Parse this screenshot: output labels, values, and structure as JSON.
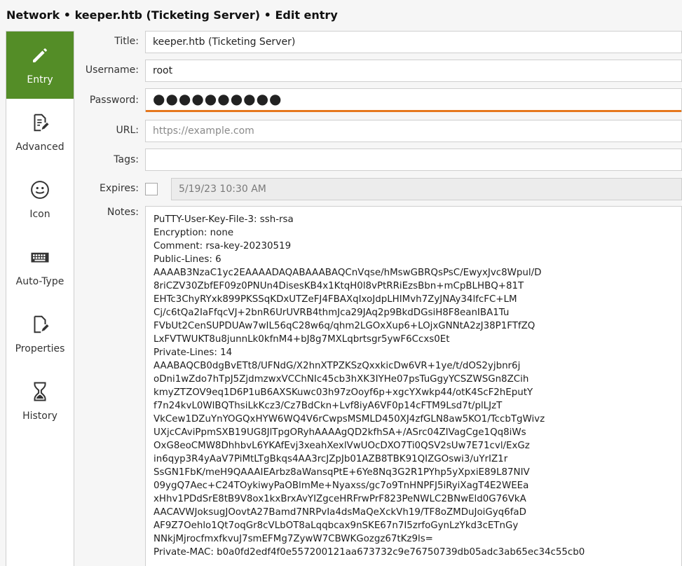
{
  "window": {
    "title": "Network • keeper.htb (Ticketing Server) • Edit entry"
  },
  "sidebar": {
    "items": [
      {
        "label": "Entry",
        "icon": "pencil-icon",
        "active": true
      },
      {
        "label": "Advanced",
        "icon": "document-edit-icon",
        "active": false
      },
      {
        "label": "Icon",
        "icon": "smiley-icon",
        "active": false
      },
      {
        "label": "Auto-Type",
        "icon": "keyboard-icon",
        "active": false
      },
      {
        "label": "Properties",
        "icon": "document-properties-icon",
        "active": false
      },
      {
        "label": "History",
        "icon": "hourglass-icon",
        "active": false
      }
    ]
  },
  "form": {
    "title_label": "Title:",
    "title_value": "keeper.htb (Ticketing Server)",
    "username_label": "Username:",
    "username_value": "root",
    "password_label": "Password:",
    "password_value": "●●●●●●●●●●",
    "url_label": "URL:",
    "url_placeholder": "https://example.com",
    "tags_label": "Tags:",
    "tags_value": "",
    "expires_label": "Expires:",
    "expires_value": "5/19/23 10:30 AM",
    "expires_checked": false,
    "notes_label": "Notes:",
    "notes_value": "PuTTY-User-Key-File-3: ssh-rsa\nEncryption: none\nComment: rsa-key-20230519\nPublic-Lines: 6\nAAAAB3NzaC1yc2EAAAADAQABAAABAQCnVqse/hMswGBRQsPsC/EwyxJvc8Wpul/D\n8riCZV30ZbfEF09z0PNUn4DisesKB4x1KtqH0l8vPtRRiEzsBbn+mCpBLHBQ+81T\nEHTc3ChyRYxk899PKSSqKDxUTZeFJ4FBAXqIxoJdpLHIMvh7ZyJNAy34lfcFC+LM\nCj/c6tQa2IaFfqcVJ+2bnR6UrUVRB4thmJca29JAq2p9BkdDGsiH8F8eanIBA1Tu\nFVbUt2CenSUPDUAw7wIL56qC28w6q/qhm2LGOxXup6+LOjxGNNtA2zJ38P1FTfZQ\nLxFVTWUKT8u8junnLk0kfnM4+bJ8g7MXLqbrtsgr5ywF6Ccxs0Et\nPrivate-Lines: 14\nAAABAQCB0dgBvETt8/UFNdG/X2hnXTPZKSzQxxkicDw6VR+1ye/t/dOS2yjbnr6j\noDni1wZdo7hTpJ5ZjdmzwxVCChNIc45cb3hXK3IYHe07psTuGgyYCSZWSGn8ZCih\nkmyZTZOV9eq1D6P1uB6AXSKuwc03h97zOoyf6p+xgcYXwkp44/otK4ScF2hEputY\nf7n24kvL0WlBQThsiLkKcz3/Cz7BdCkn+Lvf8iyA6VF0p14cFTM9Lsd7t/plLJzT\nVkCew1DZuYnYOGQxHYW6WQ4V6rCwpsMSMLD450XJ4zfGLN8aw5KO1/TccbTgWivz\nUXjcCAviPpmSXB19UG8JlTpgORyhAAAAgQD2kfhSA+/ASrc04ZIVagCge1Qq8iWs\nOxG8eoCMW8DhhbvL6YKAfEvj3xeahXexlVwUOcDXO7Ti0QSV2sUw7E71cvl/ExGz\nin6qyp3R4yAaV7PiMtLTgBkqs4AA3rcJZpJb01AZB8TBK91QIZGOswi3/uYrIZ1r\nSsGN1FbK/meH9QAAAIEArbz8aWansqPtE+6Ye8Nq3G2R1PYhp5yXpxiE89L87NIV\n09ygQ7Aec+C24TOykiwyPaOBlmMe+Nyaxss/gc7o9TnHNPFJ5iRyiXagT4E2WEEa\nxHhv1PDdSrE8tB9V8ox1kxBrxAvYIZgceHRFrwPrF823PeNWLC2BNwEld0G76VkA\nAACAVWJoksugJOovtA27Bamd7NRPvIa4dsMaQeXckVh19/TF8oZMDuJoiGyq6faD\nAF9Z7Oehlo1Qt7oqGr8cVLbOT8aLqqbcax9nSKE67n7I5zrfoGynLzYkd3cETnGy\nNNkjMjrocfmxfkvuJ7smEFMg7ZywW7CBWKGozgz67tKz9ls=\nPrivate-MAC: b0a0fd2edf4f0e557200121aa673732c9e76750739db05adc3ab65ec34c55cb0"
  }
}
